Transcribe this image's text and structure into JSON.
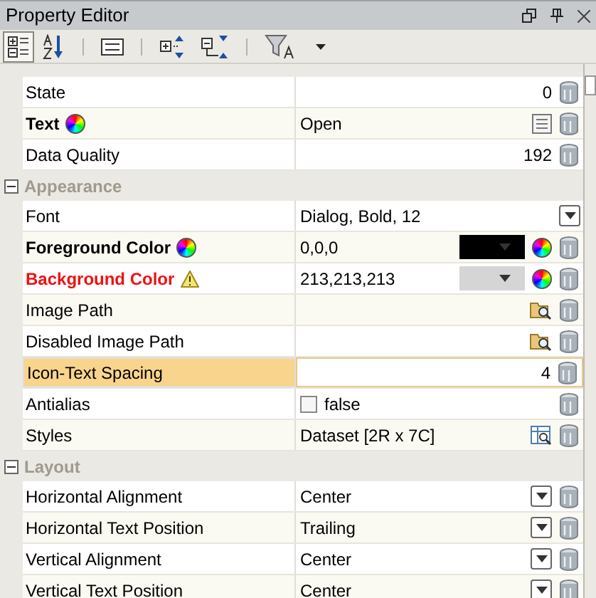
{
  "window": {
    "title": "Property Editor"
  },
  "toolbar": [
    {
      "kind": "categorized",
      "selected": true
    },
    {
      "kind": "alphabetical",
      "selected": false
    },
    {
      "kind": "sheet",
      "selected": false
    },
    {
      "kind": "expand",
      "selected": false
    },
    {
      "kind": "collapse",
      "selected": false
    },
    {
      "kind": "filter",
      "selected": false
    }
  ],
  "sections": [
    {
      "rows": [
        {
          "name": "State",
          "value": "0",
          "kind": "number"
        },
        {
          "name": "Text",
          "value": "Open",
          "kind": "note",
          "bold": true,
          "bound": true
        },
        {
          "name": "Data Quality",
          "value": "192",
          "kind": "number"
        }
      ]
    },
    {
      "title": "Appearance",
      "expanded": true,
      "rows": [
        {
          "name": "Font",
          "value": "Dialog, Bold, 12",
          "kind": "font"
        },
        {
          "name": "Foreground Color",
          "value": "0,0,0",
          "kind": "color",
          "color": "#000000",
          "bold": true,
          "bound": true
        },
        {
          "name": "Background Color",
          "value": "213,213,213",
          "kind": "color",
          "color": "#d5d5d5",
          "bold": true,
          "warning": true
        },
        {
          "name": "Image Path",
          "kind": "path"
        },
        {
          "name": "Disabled Image Path",
          "kind": "path"
        },
        {
          "name": "Icon-Text Spacing",
          "value": "4",
          "kind": "number",
          "selected": true
        },
        {
          "name": "Antialias",
          "value": "false",
          "kind": "checkbox",
          "checked": false
        },
        {
          "name": "Styles",
          "value": "Dataset [2R x 7C]",
          "kind": "dataset"
        }
      ]
    },
    {
      "title": "Layout",
      "expanded": true,
      "rows": [
        {
          "name": "Horizontal Alignment",
          "value": "Center",
          "kind": "select"
        },
        {
          "name": "Horizontal Text Position",
          "value": "Trailing",
          "kind": "select"
        },
        {
          "name": "Vertical Alignment",
          "value": "Center",
          "kind": "select"
        },
        {
          "name": "Vertical Text Position",
          "value": "Center",
          "kind": "select"
        }
      ]
    }
  ]
}
